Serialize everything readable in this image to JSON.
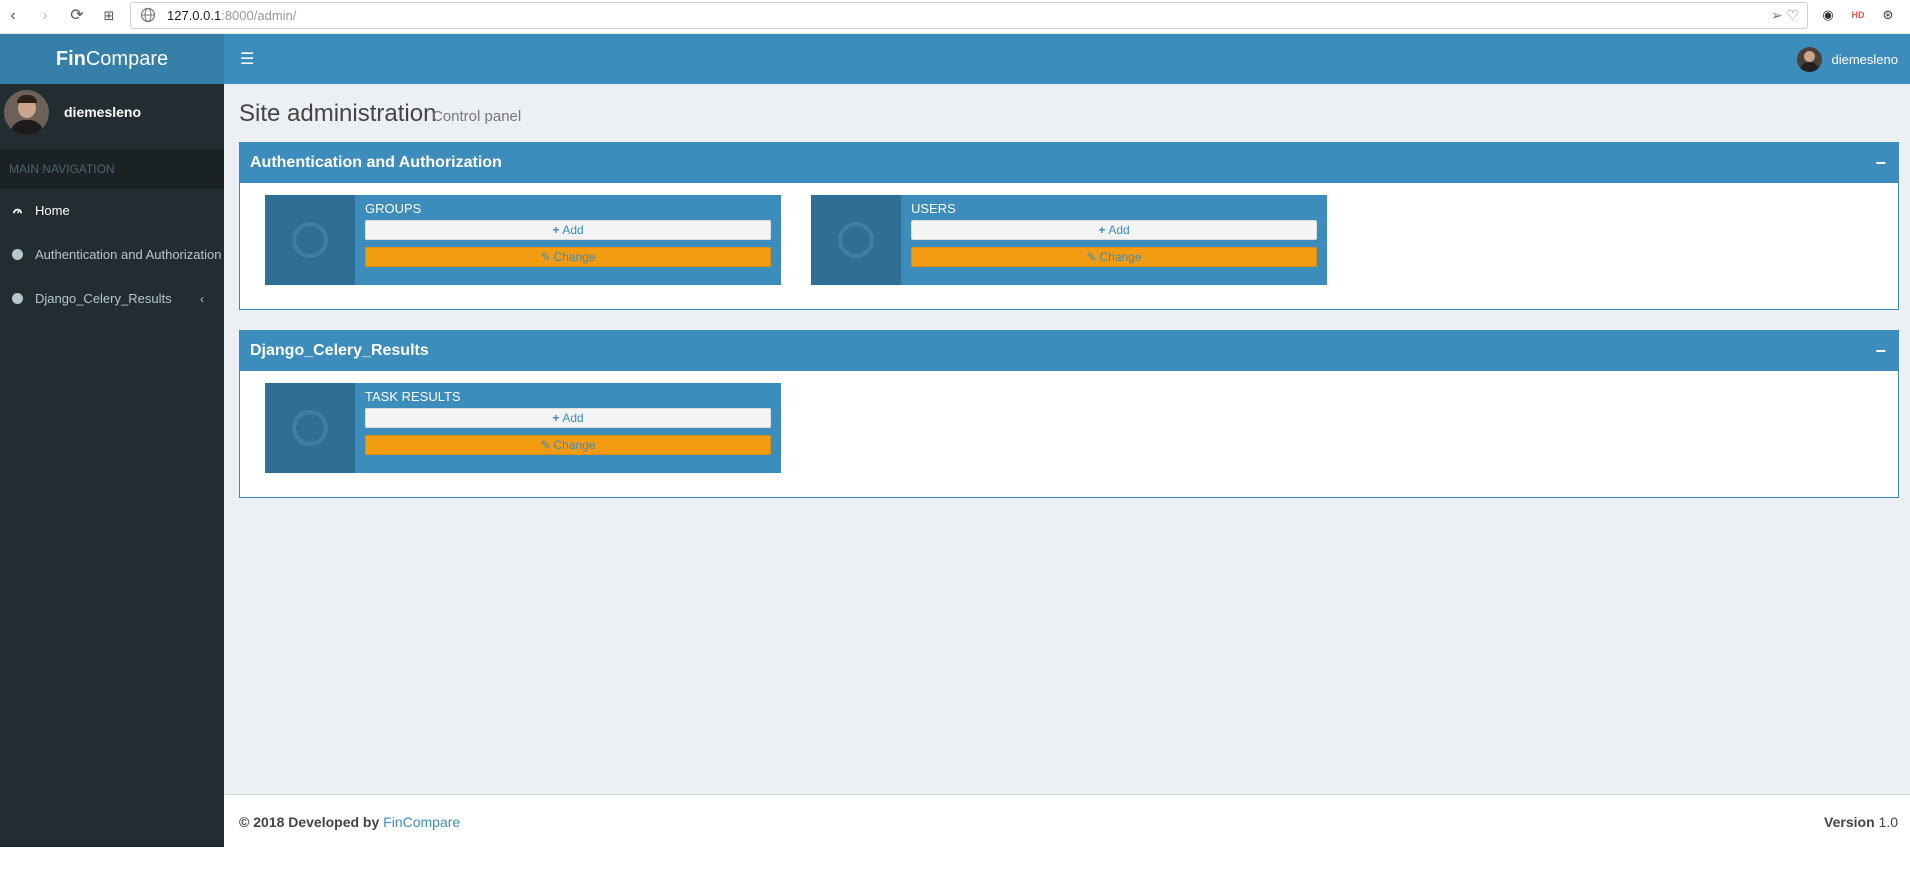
{
  "browser": {
    "url_host": "127.0.0.1",
    "url_rest": ":8000/admin/",
    "ext_hd": "HD"
  },
  "brand": {
    "bold": "Fin",
    "rest": "Compare"
  },
  "header": {
    "user_name": "diemesleno"
  },
  "sidebar": {
    "user_name": "diemesleno",
    "nav_header": "MAIN NAVIGATION",
    "items": [
      {
        "label": "Home",
        "icon": "dashboard-icon"
      },
      {
        "label": "Authentication and Authorization",
        "icon": "circle-icon"
      },
      {
        "label": "Django_Celery_Results",
        "icon": "circle-icon"
      }
    ],
    "chevron": "‹"
  },
  "page": {
    "title": "Site administration",
    "subtitle": "Control panel"
  },
  "apps": [
    {
      "name": "Authentication and Authorization",
      "collapse": "−",
      "models": [
        {
          "name": "GROUPS",
          "add": "Add",
          "change": "Change"
        },
        {
          "name": "USERS",
          "add": "Add",
          "change": "Change"
        }
      ]
    },
    {
      "name": "Django_Celery_Results",
      "collapse": "−",
      "models": [
        {
          "name": "TASK RESULTS",
          "add": "Add",
          "change": "Change"
        }
      ]
    }
  ],
  "footer": {
    "copyright": "© 2018 Developed by",
    "link": "FinCompare",
    "version_label": "Version",
    "version": "1.0"
  },
  "colors": {
    "primary": "#3c8dbc",
    "sidebar": "#222d32",
    "change_button": "#f39c12",
    "content_bg": "#ecf0f5"
  }
}
